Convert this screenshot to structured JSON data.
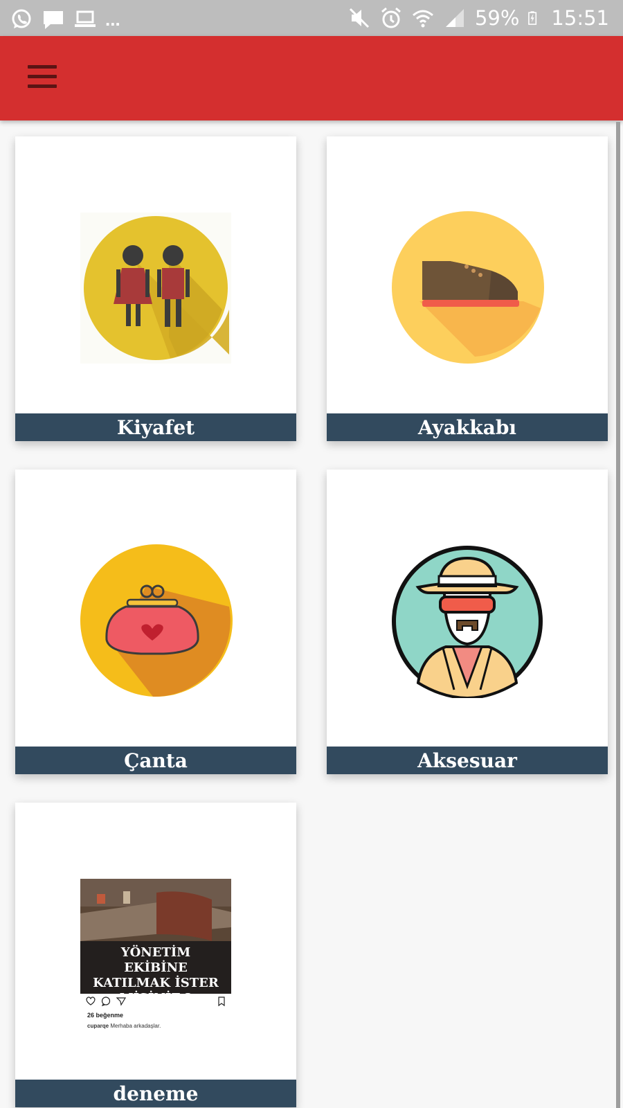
{
  "status_bar": {
    "battery": "59%",
    "time": "15:51",
    "more": "...",
    "icons_left": [
      "whatsapp-icon",
      "message-icon",
      "laptop-icon"
    ],
    "icons_right": [
      "mute-icon",
      "alarm-icon",
      "wifi-icon",
      "signal-icon",
      "battery-charging-icon"
    ]
  },
  "app_bar": {
    "menu_icon": "hamburger-menu-icon",
    "color": "#d42f2f"
  },
  "categories": [
    {
      "label": "Kiyafet",
      "icon": "clothing-people-icon"
    },
    {
      "label": "Ayakkabı",
      "icon": "shoe-icon"
    },
    {
      "label": "Çanta",
      "icon": "purse-icon"
    },
    {
      "label": "Aksesuar",
      "icon": "detective-hat-glasses-icon"
    },
    {
      "label": "deneme",
      "icon": "instagram-post-image",
      "post": {
        "heading": "YÖNETİM EKİBİNE KATILMAK İSTER MİSİNİZ ?",
        "likes": "26 beğenme",
        "caption_user": "cuparqe",
        "caption_text": "Merhaba arkadaşlar."
      }
    }
  ],
  "colors": {
    "footer": "#324a5e",
    "background": "#f7f7f7"
  }
}
